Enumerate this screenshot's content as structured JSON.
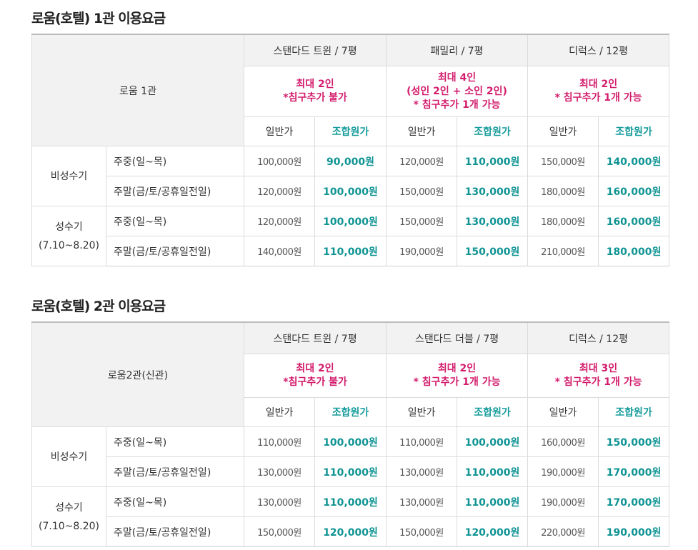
{
  "sections": [
    {
      "title": "로움(호텔) 1관 이용요금",
      "corner_label": "로움 1관",
      "rooms": [
        {
          "name": "스탠다드 트윈 / 7평",
          "capacity": "최대 2인\n*침구추가 불가"
        },
        {
          "name": "패밀리 / 7평",
          "capacity": "최대 4인\n(성인 2인 + 소인 2인)\n* 침구추가 1개 가능"
        },
        {
          "name": "디럭스 / 12평",
          "capacity": "최대 2인\n* 침구추가 1개 가능"
        }
      ],
      "price_kinds": [
        "일반가",
        "조합원가"
      ],
      "seasons": [
        {
          "label": "비성수기",
          "rows": [
            {
              "period": "주중(일~목)",
              "prices": [
                "100,000원",
                "90,000원",
                "120,000원",
                "110,000원",
                "150,000원",
                "140,000원"
              ]
            },
            {
              "period": "주말(금/토/공휴일전일)",
              "prices": [
                "120,000원",
                "100,000원",
                "150,000원",
                "130,000원",
                "180,000원",
                "160,000원"
              ]
            }
          ]
        },
        {
          "label": "성수기\n(7.10~8.20)",
          "rows": [
            {
              "period": "주중(일~목)",
              "prices": [
                "120,000원",
                "100,000원",
                "150,000원",
                "130,000원",
                "180,000원",
                "160,000원"
              ]
            },
            {
              "period": "주말(금/토/공휴일전일)",
              "prices": [
                "140,000원",
                "110,000원",
                "190,000원",
                "150,000원",
                "210,000원",
                "180,000원"
              ]
            }
          ]
        }
      ]
    },
    {
      "title": "로움(호텔) 2관 이용요금",
      "corner_label": "로움2관(신관)",
      "rooms": [
        {
          "name": "스탠다드 트윈 / 7평",
          "capacity": "최대 2인\n*침구추가 불가"
        },
        {
          "name": "스탠다드 더블 / 7평",
          "capacity": "최대 2인\n* 침구추가 1개 가능"
        },
        {
          "name": "디럭스 / 12평",
          "capacity": "최대 3인\n* 침구추가 1개 가능"
        }
      ],
      "price_kinds": [
        "일반가",
        "조합원가"
      ],
      "seasons": [
        {
          "label": "비성수기",
          "rows": [
            {
              "period": "주중(일~목)",
              "prices": [
                "110,000원",
                "100,000원",
                "110,000원",
                "100,000원",
                "160,000원",
                "150,000원"
              ]
            },
            {
              "period": "주말(금/토/공휴일전일)",
              "prices": [
                "130,000원",
                "110,000원",
                "130,000원",
                "110,000원",
                "190,000원",
                "170,000원"
              ]
            }
          ]
        },
        {
          "label": "성수기\n(7.10~8.20)",
          "rows": [
            {
              "period": "주중(일~목)",
              "prices": [
                "130,000원",
                "110,000원",
                "130,000원",
                "110,000원",
                "190,000원",
                "170,000원"
              ]
            },
            {
              "period": "주말(금/토/공휴일전일)",
              "prices": [
                "150,000원",
                "120,000원",
                "150,000원",
                "120,000원",
                "220,000원",
                "190,000원"
              ]
            }
          ]
        }
      ]
    }
  ],
  "colors": {
    "capacity_text": "#d31c6c",
    "member_price": "#0f9393",
    "header_bg": "#f2f2f2"
  }
}
